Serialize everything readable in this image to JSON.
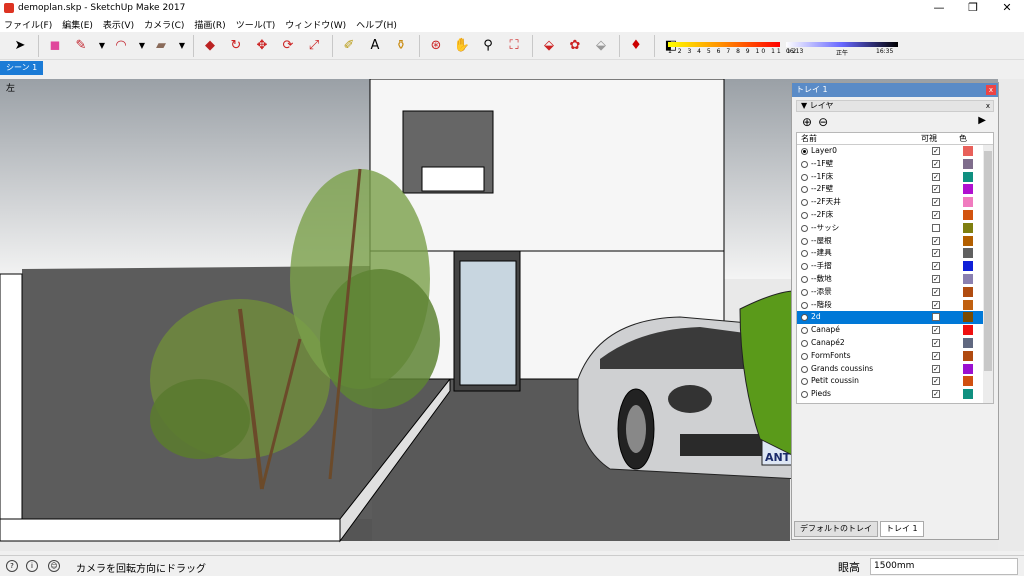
{
  "window": {
    "title": "demoplan.skp - SketchUp Make 2017",
    "controls": [
      "—",
      "❐",
      "✕"
    ]
  },
  "menu": [
    "ファイル(F)",
    "編集(E)",
    "表示(V)",
    "カメラ(C)",
    "描画(R)",
    "ツール(T)",
    "ウィンドウ(W)",
    "ヘルプ(H)"
  ],
  "toolbar": {
    "tools": [
      "select-arrow-icon",
      "eraser-icon",
      "pencil-icon",
      "arc-icon",
      "rectangle-icon",
      "push-pull-icon",
      "follow-me-icon",
      "move-icon",
      "rotate-icon",
      "scale-icon",
      "tape-measure-icon",
      "text-icon",
      "paint-bucket-icon",
      "orbit-icon",
      "pan-icon",
      "zoom-icon",
      "zoom-extents-icon",
      "warehouse-icon",
      "extension-icon",
      "share-model-icon",
      "ruby-icon"
    ]
  },
  "shadows": {
    "month_numbers": "1 2 3 4 5 6 7 8 9 10 11 12",
    "time_start": "06:13",
    "time_noon": "正午",
    "time_end": "16:35"
  },
  "scene_tab": "シーン 1",
  "viewport": {
    "view_label": "左"
  },
  "tray": {
    "title": "トレイ 1",
    "panel_title": "▼ レイヤ",
    "col_name": "名前",
    "col_visible": "可視",
    "col_color": "色",
    "layers": [
      {
        "name": "Layer0",
        "active": true,
        "visible": true,
        "color": "#e8605a"
      },
      {
        "name": "--1F壁",
        "active": false,
        "visible": true,
        "color": "#7f6d8c"
      },
      {
        "name": "--1F床",
        "active": false,
        "visible": true,
        "color": "#0f8f80"
      },
      {
        "name": "--2F壁",
        "active": false,
        "visible": true,
        "color": "#b010d0"
      },
      {
        "name": "--2F天井",
        "active": false,
        "visible": true,
        "color": "#f07bbf"
      },
      {
        "name": "--2F床",
        "active": false,
        "visible": true,
        "color": "#d2530e"
      },
      {
        "name": "--サッシ",
        "active": false,
        "visible": false,
        "color": "#7f7f10"
      },
      {
        "name": "--屋根",
        "active": false,
        "visible": true,
        "color": "#b35f00"
      },
      {
        "name": "--建具",
        "active": false,
        "visible": true,
        "color": "#606060"
      },
      {
        "name": "--手摺",
        "active": false,
        "visible": true,
        "color": "#1020d8"
      },
      {
        "name": "--敷地",
        "active": false,
        "visible": true,
        "color": "#8a80b0"
      },
      {
        "name": "--添景",
        "active": false,
        "visible": true,
        "color": "#b04c10"
      },
      {
        "name": "--階段",
        "active": false,
        "visible": true,
        "color": "#c06010"
      },
      {
        "name": "2d",
        "active": false,
        "visible": false,
        "color": "#7a4a00",
        "selected": true
      },
      {
        "name": "Canapé",
        "active": false,
        "visible": true,
        "color": "#ef1010"
      },
      {
        "name": "Canapé2",
        "active": false,
        "visible": true,
        "color": "#606880"
      },
      {
        "name": "FormFonts",
        "active": false,
        "visible": true,
        "color": "#b04a10"
      },
      {
        "name": "Grands coussins",
        "active": false,
        "visible": true,
        "color": "#9a10d0"
      },
      {
        "name": "Petit coussin",
        "active": false,
        "visible": true,
        "color": "#d05010"
      },
      {
        "name": "Pieds",
        "active": false,
        "visible": true,
        "color": "#109080"
      }
    ],
    "tabs": [
      "デフォルトのトレイ",
      "トレイ 1"
    ]
  },
  "status": {
    "hint": "カメラを回転方向にドラッグ",
    "vcb_label": "眼高",
    "vcb_value": "1500mm"
  },
  "car": {
    "plate": "ANT"
  }
}
